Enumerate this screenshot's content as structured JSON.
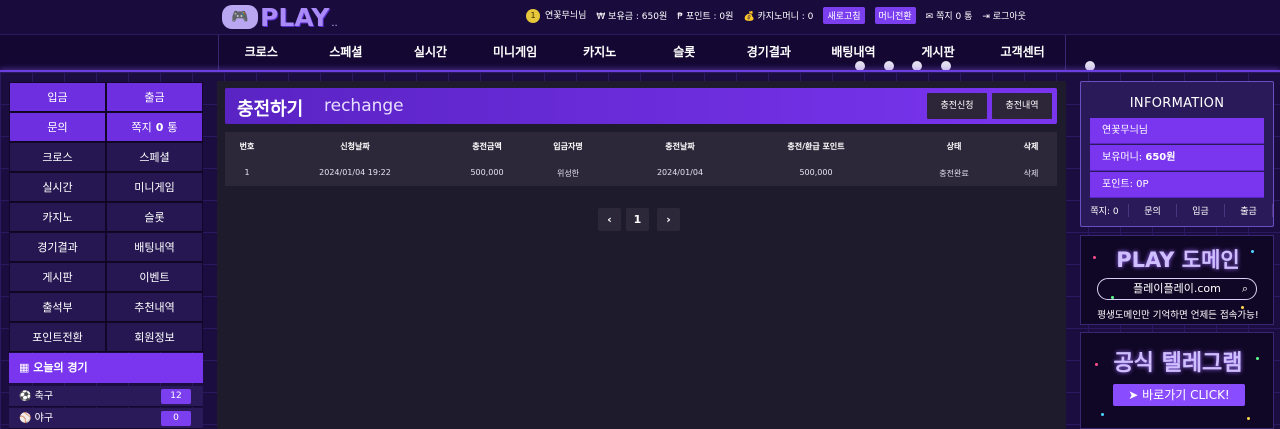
{
  "logo": {
    "text": "PLAY",
    "dots": ".."
  },
  "user": {
    "name": "연꽃무늬님",
    "balance_label": "보유금 : 650원",
    "points_label": "포인트 : 0원",
    "casino_label": "카지노머니 : 0",
    "refresh_btn": "새로고침",
    "money_btn": "머니전환",
    "msg_label": "쪽지 0 통",
    "logout": "로그아웃"
  },
  "nav": [
    "크로스",
    "스페셜",
    "실시간",
    "미니게임",
    "카지노",
    "슬롯",
    "경기결과",
    "배팅내역",
    "게시판",
    "고객센터"
  ],
  "leftnav": [
    {
      "label": "입금",
      "hi": true
    },
    {
      "label": "출금",
      "hi": true
    },
    {
      "label": "문의",
      "hi": true
    },
    {
      "label": "쪽지",
      "count": "0",
      "unit": "통",
      "hi": true
    },
    {
      "label": "크로스",
      "hi": false
    },
    {
      "label": "스페셜",
      "hi": false
    },
    {
      "label": "실시간",
      "hi": false
    },
    {
      "label": "미니게임",
      "hi": false
    },
    {
      "label": "카지노",
      "hi": false
    },
    {
      "label": "슬롯",
      "hi": false
    },
    {
      "label": "경기결과",
      "hi": false
    },
    {
      "label": "배팅내역",
      "hi": false
    },
    {
      "label": "게시판",
      "hi": false
    },
    {
      "label": "이벤트",
      "hi": false
    },
    {
      "label": "출석부",
      "hi": false
    },
    {
      "label": "추천내역",
      "hi": false
    },
    {
      "label": "포인트전환",
      "hi": false
    },
    {
      "label": "회원정보",
      "hi": false
    }
  ],
  "today": {
    "title": "오늘의 경기",
    "sports": [
      {
        "name": "축구",
        "count": "12"
      },
      {
        "name": "야구",
        "count": "0"
      }
    ]
  },
  "page": {
    "title": "충전하기",
    "subtitle": "rechange",
    "btn_apply": "충전신청",
    "btn_history": "충전내역",
    "columns": [
      "번호",
      "신청날짜",
      "충전금액",
      "입금자명",
      "충전날짜",
      "충전/환급 포인트",
      "상태",
      "삭제"
    ],
    "rows": [
      [
        "1",
        "2024/01/04 19:22",
        "500,000",
        "위성한",
        "2024/01/04",
        "500,000",
        "충전완료",
        "삭제"
      ]
    ],
    "pager": {
      "prev": "‹",
      "current": "1",
      "next": "›"
    }
  },
  "info": {
    "title": "INFORMATION",
    "name": "연꽃무늬님",
    "money_label": "보유머니: ",
    "money_value": "650원",
    "points_label": "포인트: ",
    "points_value": "0P",
    "links": [
      "쪽지: 0",
      "문의",
      "입금",
      "출금"
    ]
  },
  "banner1": {
    "title": "PLAY 도메인",
    "url": "플레이플레이.com",
    "ticker": "평생도메인만 기억하면 언제든 접속가능!"
  },
  "banner2": {
    "title": "공식 텔레그램",
    "button": "바로가기 CLICK!"
  },
  "colors": {
    "accent": "#7a35ef",
    "nav_bg": "#140833",
    "panel_bg": "#1e1b2c"
  }
}
